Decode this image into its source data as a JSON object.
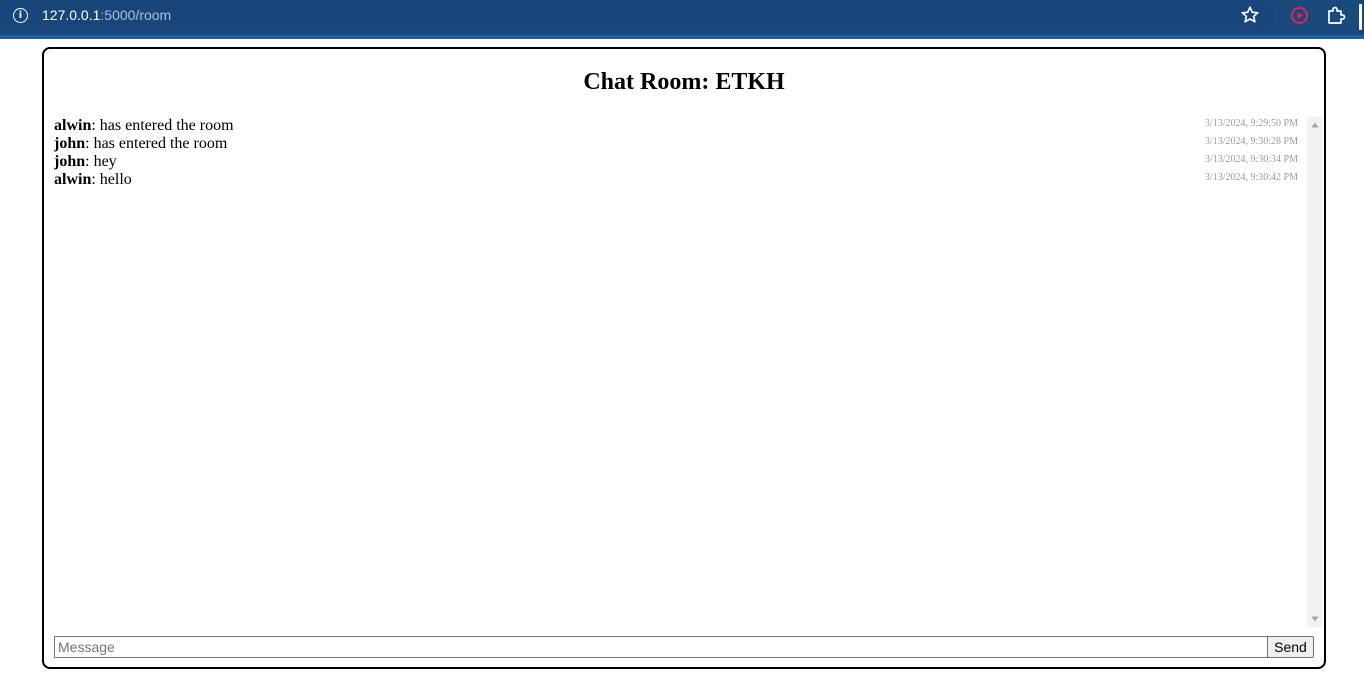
{
  "browser": {
    "url_host": "127.0.0.1",
    "url_path": ":5000/room",
    "icons": [
      "info-icon",
      "star-icon",
      "ext-record-icon",
      "puzzle-icon"
    ],
    "colors": {
      "toolbar": "#1a4a7c",
      "extension_accent": "#e0245e"
    }
  },
  "chat": {
    "title": "Chat Room: ETKH",
    "messages": [
      {
        "name": "alwin",
        "text": ": has entered the room",
        "time": "3/13/2024, 9:29:50 PM"
      },
      {
        "name": "john",
        "text": ": has entered the room",
        "time": "3/13/2024, 9:30:28 PM"
      },
      {
        "name": "john",
        "text": ": hey",
        "time": "3/13/2024, 9:30:34 PM"
      },
      {
        "name": "alwin",
        "text": ": hello",
        "time": "3/13/2024, 9:30:42 PM"
      }
    ],
    "input": {
      "placeholder": "Message",
      "value": ""
    },
    "send_label": "Send"
  }
}
